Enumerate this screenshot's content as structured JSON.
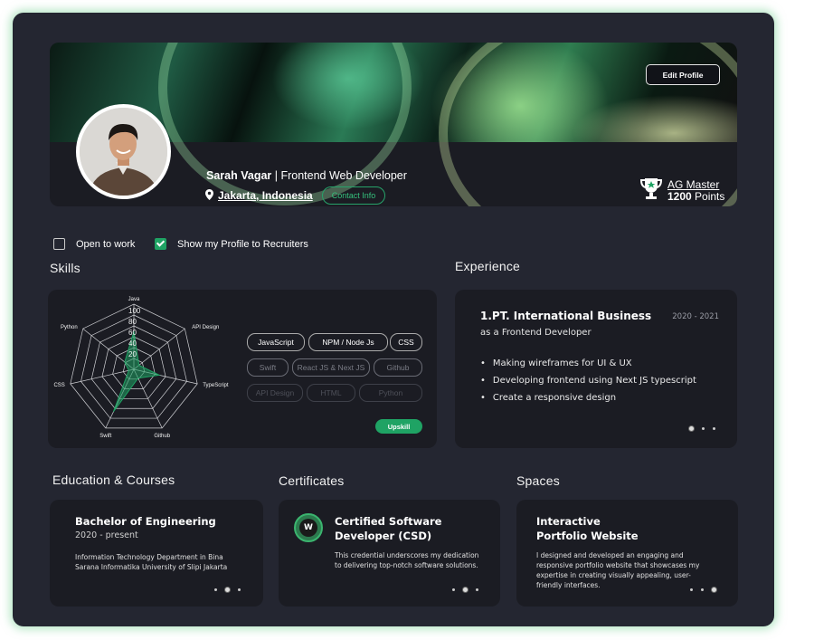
{
  "header": {
    "edit_profile_label": "Edit Profile",
    "name": "Sarah Vagar",
    "separator": " | ",
    "role": "Frontend Web Developer",
    "location": "Jakarta, Indonesia",
    "contact_label": "Contact Info",
    "badge_level": "AG Master",
    "badge_points_value": "1200",
    "badge_points_unit": " Points"
  },
  "preferences": {
    "open_to_work_label": "Open to work",
    "open_to_work_checked": false,
    "show_profile_label": "Show my Profile to Recruiters",
    "show_profile_checked": true
  },
  "skills": {
    "section_title": "Skills",
    "radar": {
      "axes": [
        "Java",
        "API Design",
        "TypeScript",
        "Github",
        "Swift",
        "CSS",
        "Python"
      ],
      "ticks": [
        "100",
        "80",
        "60",
        "40",
        "20"
      ],
      "values": [
        58,
        10,
        40,
        15,
        72,
        8,
        18
      ]
    },
    "chips": [
      {
        "label": "JavaScript",
        "state": "active"
      },
      {
        "label": "NPM / Node Js",
        "state": "active"
      },
      {
        "label": "CSS",
        "state": "active"
      },
      {
        "label": "Swift",
        "state": "dim"
      },
      {
        "label": "React JS  &  Next JS",
        "state": "dim"
      },
      {
        "label": "Github",
        "state": "dim"
      },
      {
        "label": "API Design",
        "state": "faint"
      },
      {
        "label": "HTML",
        "state": "faint"
      },
      {
        "label": "Python",
        "state": "faint"
      }
    ],
    "upskill_label": "Upskill"
  },
  "experience": {
    "section_title": "Experience",
    "title": "1.PT. International Business",
    "date": "2020 - 2021",
    "subtitle": "as a Frontend Developer",
    "bullets": [
      "Making wireframes for UI & UX",
      "Developing frontend using Next JS typescript",
      "Create a responsive design"
    ]
  },
  "education": {
    "section_title": "Education & Courses",
    "title": "Bachelor of Engineering",
    "period": "2020 - present",
    "desc_line1": "Information Technology Department in Bina",
    "desc_line2": "Sarana Informatika University of Slipi Jakarta"
  },
  "certificates": {
    "section_title": "Certificates",
    "title_line1": "Certified Software",
    "title_line2": "Developer (CSD)",
    "desc_line1": "This credential underscores my dedication",
    "desc_line2": "to delivering top-notch software solutions.",
    "logo_text": "W"
  },
  "spaces": {
    "section_title": "Spaces",
    "title_line1": "Interactive",
    "title_line2": "Portfolio Website",
    "desc_line1": "I designed and developed an engaging and",
    "desc_line2": "responsive portfolio website that showcases my",
    "desc_line3": "expertise in creating visually appealing, user-",
    "desc_line4": "friendly interfaces."
  },
  "colors": {
    "accent": "#1fa364",
    "background": "#242631",
    "card": "#1b1c23"
  }
}
